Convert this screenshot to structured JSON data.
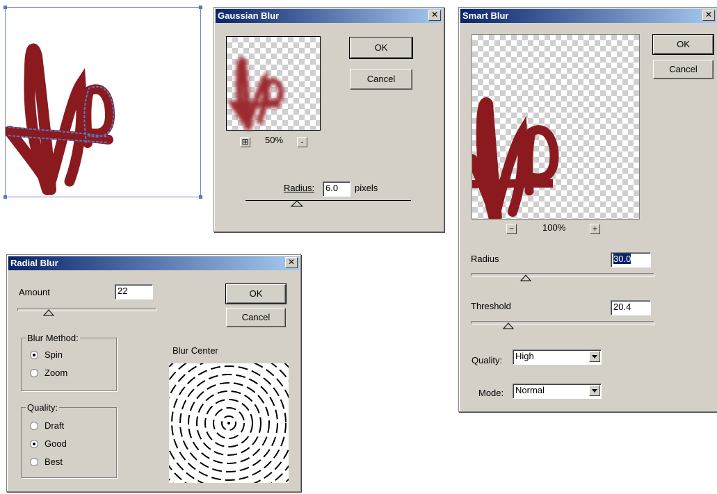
{
  "canvas": {
    "brand_color": "#8b1a1f",
    "selection_color": "#5577cc"
  },
  "gaussian": {
    "title": "Gaussian Blur",
    "ok": "OK",
    "cancel": "Cancel",
    "zoom": "50%",
    "radius_label": "Radius:",
    "radius_value": "6.0",
    "units": "pixels"
  },
  "smart": {
    "title": "Smart Blur",
    "ok": "OK",
    "cancel": "Cancel",
    "zoom": "100%",
    "radius_label": "Radius",
    "radius_value": "30.0",
    "threshold_label": "Threshold",
    "threshold_value": "20.4",
    "quality_label": "Quality:",
    "quality_value": "High",
    "mode_label": "Mode:",
    "mode_value": "Normal"
  },
  "radial": {
    "title": "Radial Blur",
    "amount_label": "Amount",
    "amount_value": "22",
    "ok": "OK",
    "cancel": "Cancel",
    "blur_method_label": "Blur Method:",
    "method_options": [
      "Spin",
      "Zoom"
    ],
    "method_selected": "Spin",
    "quality_label": "Quality:",
    "quality_options": [
      "Draft",
      "Good",
      "Best"
    ],
    "quality_selected": "Good",
    "blur_center_label": "Blur Center"
  },
  "icons": {
    "close": "close-icon",
    "zoom_in": "zoom-in-icon",
    "zoom_out": "zoom-out-icon",
    "slider": "slider-thumb-icon",
    "dropdown": "chevron-down-icon"
  }
}
